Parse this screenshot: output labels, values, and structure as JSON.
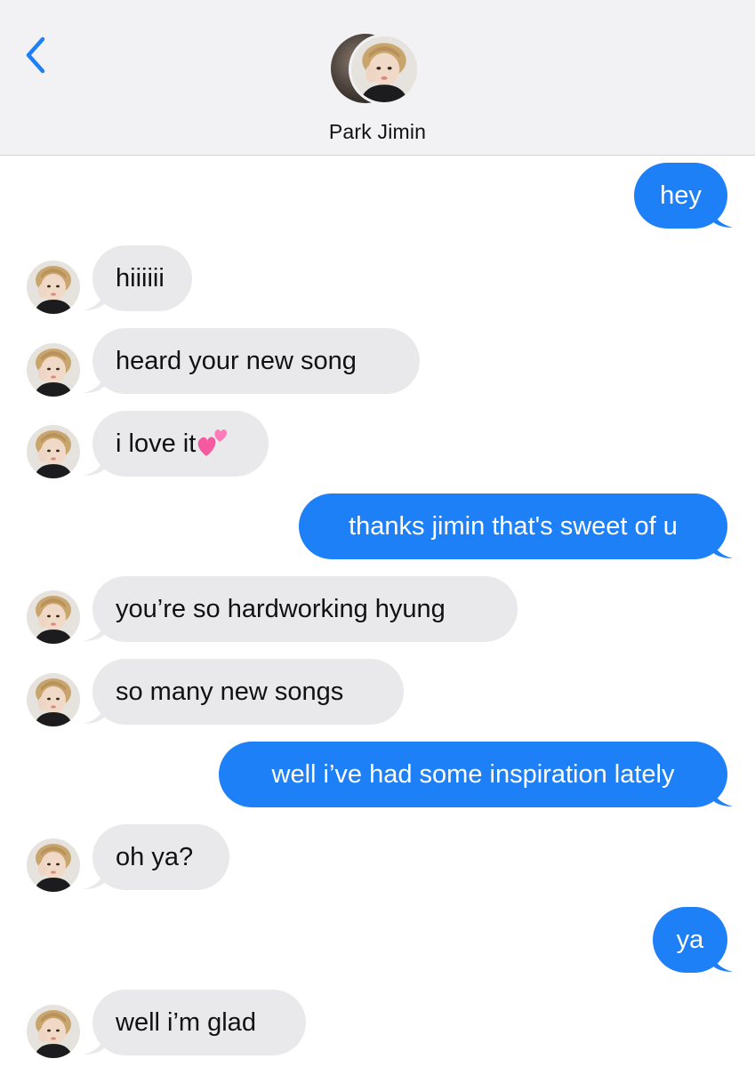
{
  "header": {
    "back_icon": "chevron-left-icon",
    "contact_name": "Park Jimin"
  },
  "colors": {
    "header_bg": "#f2f2f4",
    "sent_bubble": "#1e80f6",
    "received_bubble": "#e9e9eb",
    "accent": "#1e80f6"
  },
  "messages": [
    {
      "direction": "sent",
      "text": "hey"
    },
    {
      "direction": "received",
      "text": "hiiiiii"
    },
    {
      "direction": "received",
      "text": "heard your new song"
    },
    {
      "direction": "received",
      "text": "i love it",
      "emoji": "two-hearts-icon"
    },
    {
      "direction": "sent",
      "text": "thanks jimin that's sweet of u"
    },
    {
      "direction": "received",
      "text": "you’re so hardworking hyung"
    },
    {
      "direction": "received",
      "text": "so many new songs"
    },
    {
      "direction": "sent",
      "text": "well i’ve had some inspiration lately"
    },
    {
      "direction": "received",
      "text": "oh ya?"
    },
    {
      "direction": "sent",
      "text": "ya"
    },
    {
      "direction": "received",
      "text": "well i’m glad"
    }
  ]
}
